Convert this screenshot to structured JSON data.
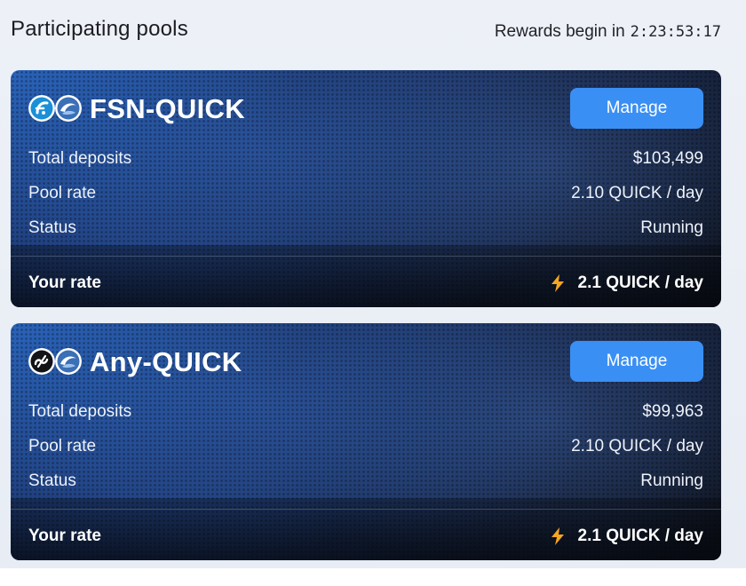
{
  "header": {
    "title": "Participating pools",
    "countdown_label": "Rewards begin in",
    "countdown_time": "2:23:53:17"
  },
  "colors": {
    "accent": "#3a8ff4",
    "bolt": "#f5a623",
    "card_dark": "#0c0f16",
    "card_blue": "#2a63b9"
  },
  "pools": [
    {
      "name": "FSN-QUICK",
      "token_icons": [
        "fsn-token-icon",
        "quick-token-icon"
      ],
      "manage_label": "Manage",
      "total_deposits_label": "Total deposits",
      "total_deposits_value": "$103,499",
      "pool_rate_label": "Pool rate",
      "pool_rate_value": "2.10 QUICK / day",
      "status_label": "Status",
      "status_value": "Running",
      "your_rate_label": "Your rate",
      "your_rate_value": "2.1 QUICK / day"
    },
    {
      "name": "Any-QUICK",
      "token_icons": [
        "any-token-icon",
        "quick-token-icon"
      ],
      "manage_label": "Manage",
      "total_deposits_label": "Total deposits",
      "total_deposits_value": "$99,963",
      "pool_rate_label": "Pool rate",
      "pool_rate_value": "2.10 QUICK / day",
      "status_label": "Status",
      "status_value": "Running",
      "your_rate_label": "Your rate",
      "your_rate_value": "2.1 QUICK / day"
    }
  ]
}
